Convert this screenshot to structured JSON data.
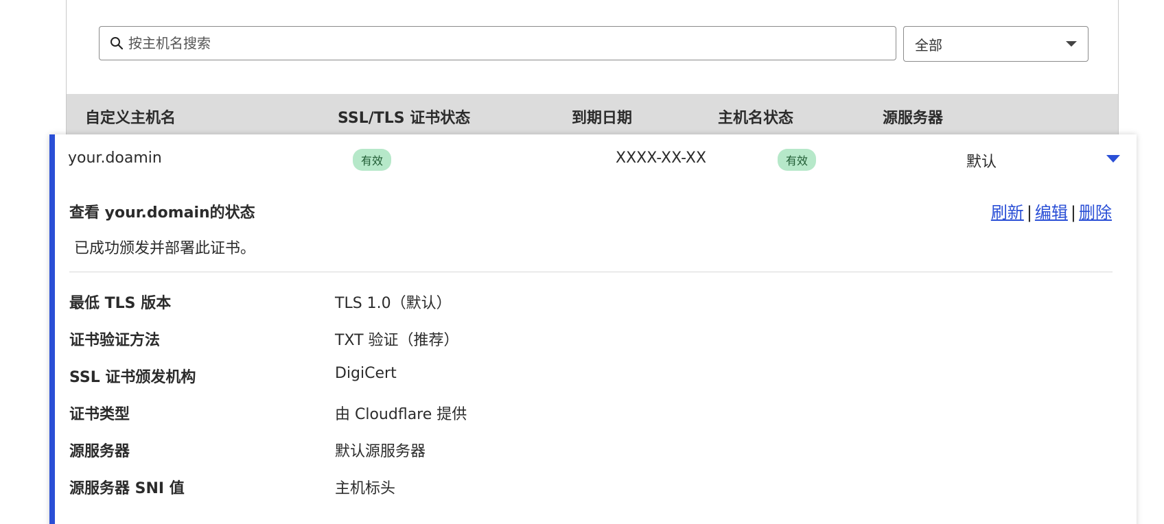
{
  "search": {
    "placeholder": "按主机名搜索",
    "value": ""
  },
  "filter": {
    "selected": "全部"
  },
  "table": {
    "headers": [
      "自定义主机名",
      "SSL/TLS 证书状态",
      "到期日期",
      "主机名状态",
      "源服务器"
    ],
    "row": {
      "hostname": "your.doamin",
      "ssl_status": "有效",
      "expiry": "XXXX-XX-XX",
      "hostname_status": "有效",
      "origin": "默认"
    }
  },
  "detail": {
    "title": "查看 your.domain的状态",
    "actions": {
      "refresh": "刷新",
      "edit": "编辑",
      "delete": "删除",
      "separator": "|"
    },
    "message": "已成功颁发并部署此证书。",
    "properties": [
      {
        "label": "最低 TLS 版本",
        "value": "TLS 1.0（默认）"
      },
      {
        "label": "证书验证方法",
        "value": "TXT 验证（推荐）"
      },
      {
        "label": "SSL 证书颁发机构",
        "value": "DigiCert"
      },
      {
        "label": "证书类型",
        "value": "由 Cloudflare 提供"
      },
      {
        "label": "源服务器",
        "value": "默认源服务器"
      },
      {
        "label": "源服务器 SNI 值",
        "value": "主机标头"
      }
    ]
  },
  "colors": {
    "accent": "#2a4fd6",
    "badge_bg": "#b6e8c9",
    "header_bg": "#dcdcdc"
  },
  "icons": {
    "search": "search-icon",
    "filter_caret": "chevron-down-icon",
    "expand": "caret-down-icon"
  }
}
